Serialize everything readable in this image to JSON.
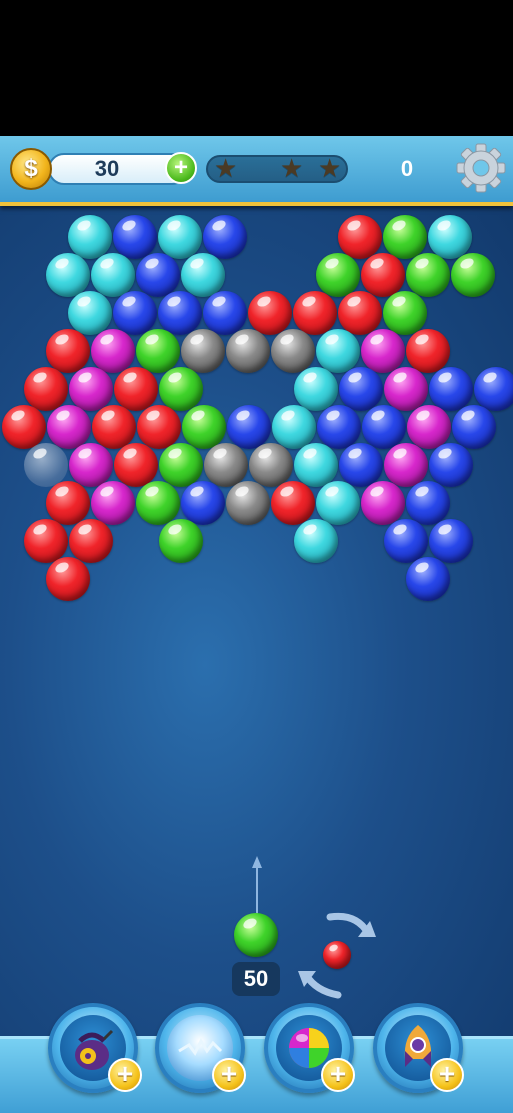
{
  "header": {
    "coins_value": "30",
    "coin_symbol": "$",
    "add_coins_label": "+",
    "stars_total": 3,
    "stars_earned": 0,
    "score_value": "0"
  },
  "shooter": {
    "shots_left": "50",
    "current_ball_color": "green",
    "next_ball_color": "red"
  },
  "boosters": [
    {
      "name": "bomb-bag",
      "plus_label": "+"
    },
    {
      "name": "lightning-orb",
      "plus_label": "+"
    },
    {
      "name": "rainbow-ball",
      "plus_label": "+"
    },
    {
      "name": "rocket",
      "plus_label": "+"
    }
  ],
  "colors": {
    "red": "#f0242a",
    "green": "#3fd32a",
    "cyan": "#3fd8e0",
    "blue": "#2847ea",
    "magenta": "#d727cc",
    "gray": "#8a8a8a",
    "accent_gold": "#f0c23a"
  },
  "board": [
    [
      "cyan",
      "blue",
      "cyan",
      "blue",
      "",
      "",
      "red",
      "green",
      "cyan",
      ""
    ],
    [
      "cyan",
      "cyan",
      "blue",
      "cyan",
      "",
      "",
      "green",
      "red",
      "green",
      "green"
    ],
    [
      "cyan",
      "blue",
      "blue",
      "blue",
      "red",
      "red",
      "red",
      "green",
      ""
    ],
    [
      "red",
      "magenta",
      "green",
      "gray",
      "gray",
      "gray",
      "cyan",
      "magenta",
      "red",
      ""
    ],
    [
      "red",
      "magenta",
      "red",
      "green",
      "",
      "",
      "cyan",
      "blue",
      "magenta",
      "blue",
      "blue"
    ],
    [
      "red",
      "magenta",
      "red",
      "red",
      "green",
      "blue",
      "cyan",
      "blue",
      "blue",
      "magenta",
      "blue"
    ],
    [
      "ghost",
      "magenta",
      "red",
      "green",
      "gray",
      "gray",
      "cyan",
      "blue",
      "magenta",
      "blue"
    ],
    [
      "red",
      "magenta",
      "green",
      "blue",
      "gray",
      "red",
      "cyan",
      "magenta",
      "blue"
    ],
    [
      "red",
      "red",
      "",
      "green",
      "",
      "",
      "cyan",
      "",
      "blue",
      "blue"
    ],
    [
      "red",
      "",
      "",
      "",
      "",
      "",
      "",
      "",
      "blue"
    ]
  ]
}
